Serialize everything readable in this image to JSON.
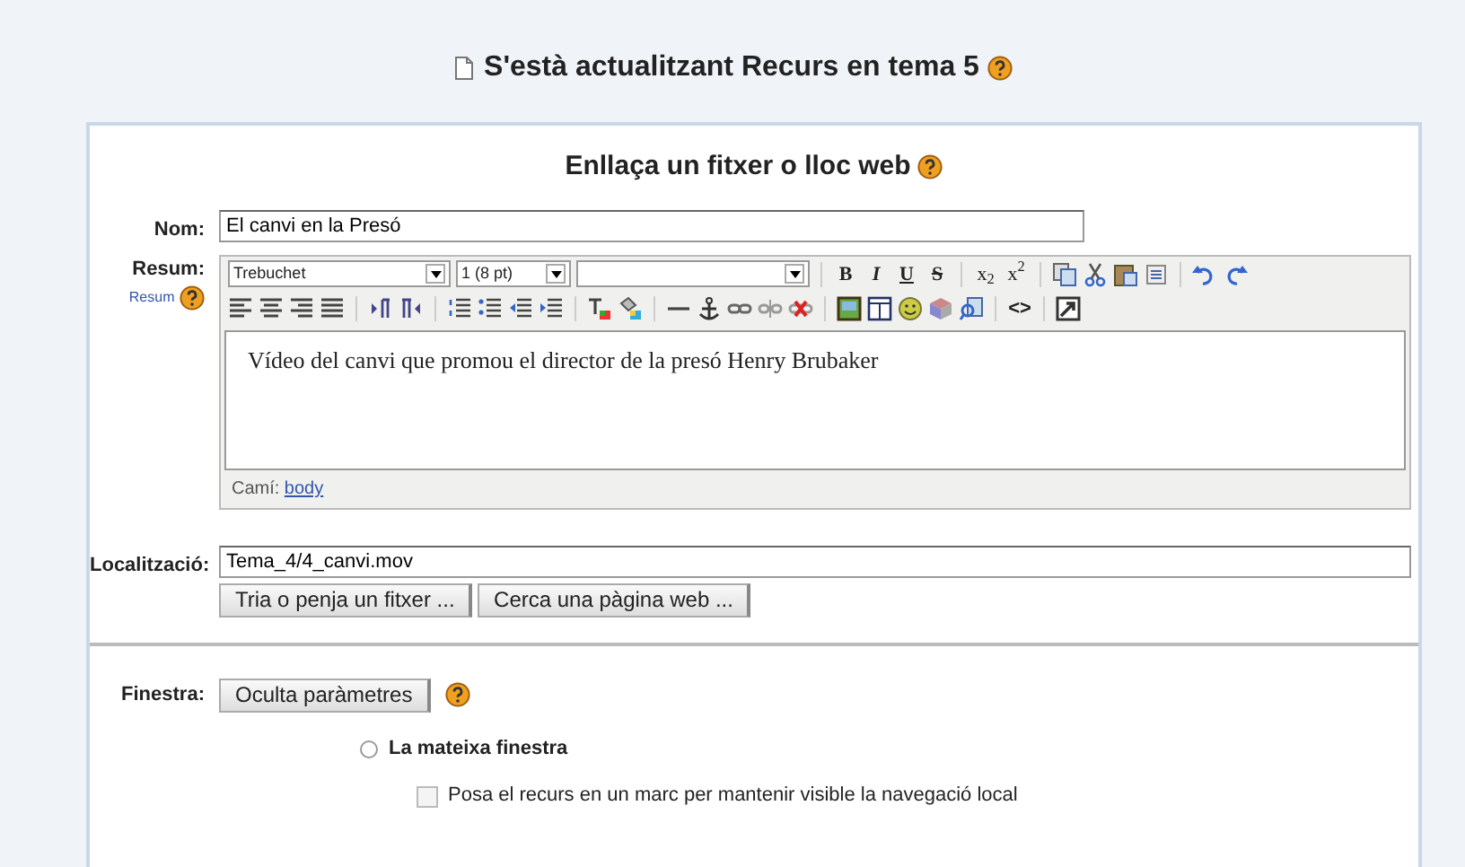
{
  "page_title": "S'està actualitzant Recurs en tema 5",
  "form": {
    "heading": "Enllaça un fitxer o lloc web",
    "name": {
      "label": "Nom:",
      "value": "El canvi en la Presó"
    },
    "summary": {
      "label": "Resum:",
      "help_link": "Resum",
      "font_select": "Trebuchet",
      "size_select": "1 (8 pt)",
      "format_buttons": [
        "B",
        "I",
        "U",
        "S"
      ],
      "script_buttons": [
        "x$_{2}$",
        "x$^{2}$"
      ],
      "code_button": "<>",
      "text": "Vídeo del canvi que promou el director de la presó Henry Brubaker",
      "path_label": "Camí:",
      "path_link": "body"
    },
    "location": {
      "label": "Localització:",
      "value": "Tema_4/4_canvi.mov",
      "buttons": [
        "Tria o penja un fitxer ...",
        "Cerca una pàgina web ..."
      ]
    },
    "window": {
      "label": "Finestra:",
      "button": "Oculta paràmetres",
      "options": [
        {
          "kind": "radio",
          "label": "La mateixa finestra",
          "selected": false
        },
        {
          "kind": "checkbox",
          "label": "Posa el recurs en un marc per mantenir visible la navegació local",
          "checked": false
        }
      ]
    }
  }
}
